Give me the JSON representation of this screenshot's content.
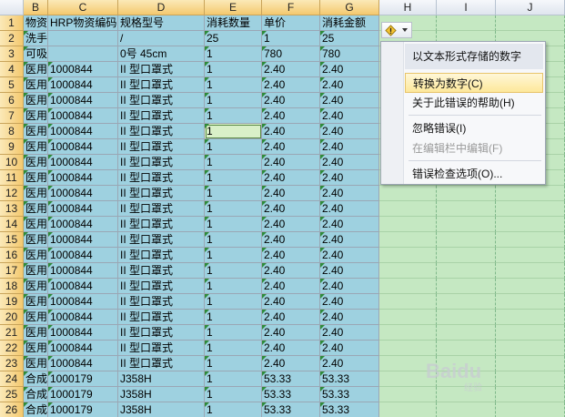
{
  "columns": [
    "B",
    "C",
    "D",
    "E",
    "F",
    "G",
    "H",
    "I",
    "J"
  ],
  "headers": [
    "物资名称",
    "HRP物资编码",
    "规格型号",
    "消耗数量",
    "单价",
    "消耗金额"
  ],
  "rows": [
    {
      "num": "1",
      "cells": [
        "物资名称",
        "HRP物资编码",
        "规格型号",
        "消耗数量",
        "单价",
        "消耗金额"
      ]
    },
    {
      "num": "2",
      "cells": [
        "洗手液",
        "",
        "/",
        "25",
        "1",
        "25"
      ]
    },
    {
      "num": "3",
      "cells": [
        "可吸收缝线",
        "",
        "0号 45cm",
        "1",
        "780",
        "780"
      ]
    },
    {
      "num": "4",
      "cells": [
        "医用口罩",
        "1000844",
        "II 型口罩式",
        "1",
        "2.40",
        "2.40"
      ]
    },
    {
      "num": "5",
      "cells": [
        "医用口罩",
        "1000844",
        "II 型口罩式",
        "1",
        "2.40",
        "2.40"
      ]
    },
    {
      "num": "6",
      "cells": [
        "医用口罩",
        "1000844",
        "II 型口罩式",
        "1",
        "2.40",
        "2.40"
      ]
    },
    {
      "num": "7",
      "cells": [
        "医用口罩",
        "1000844",
        "II 型口罩式",
        "1",
        "2.40",
        "2.40"
      ]
    },
    {
      "num": "8",
      "cells": [
        "医用口罩",
        "1000844",
        "II 型口罩式",
        "1",
        "2.40",
        "2.40"
      ]
    },
    {
      "num": "9",
      "cells": [
        "医用口罩",
        "1000844",
        "II 型口罩式",
        "1",
        "2.40",
        "2.40"
      ]
    },
    {
      "num": "10",
      "cells": [
        "医用口罩",
        "1000844",
        "II 型口罩式",
        "1",
        "2.40",
        "2.40"
      ]
    },
    {
      "num": "11",
      "cells": [
        "医用口罩",
        "1000844",
        "II 型口罩式",
        "1",
        "2.40",
        "2.40"
      ]
    },
    {
      "num": "12",
      "cells": [
        "医用口罩",
        "1000844",
        "II 型口罩式",
        "1",
        "2.40",
        "2.40"
      ]
    },
    {
      "num": "13",
      "cells": [
        "医用口罩",
        "1000844",
        "II 型口罩式",
        "1",
        "2.40",
        "2.40"
      ]
    },
    {
      "num": "14",
      "cells": [
        "医用口罩",
        "1000844",
        "II 型口罩式",
        "1",
        "2.40",
        "2.40"
      ]
    },
    {
      "num": "15",
      "cells": [
        "医用口罩",
        "1000844",
        "II 型口罩式",
        "1",
        "2.40",
        "2.40"
      ]
    },
    {
      "num": "16",
      "cells": [
        "医用口罩",
        "1000844",
        "II 型口罩式",
        "1",
        "2.40",
        "2.40"
      ]
    },
    {
      "num": "17",
      "cells": [
        "医用口罩",
        "1000844",
        "II 型口罩式",
        "1",
        "2.40",
        "2.40"
      ]
    },
    {
      "num": "18",
      "cells": [
        "医用口罩",
        "1000844",
        "II 型口罩式",
        "1",
        "2.40",
        "2.40"
      ]
    },
    {
      "num": "19",
      "cells": [
        "医用口罩",
        "1000844",
        "II 型口罩式",
        "1",
        "2.40",
        "2.40"
      ]
    },
    {
      "num": "20",
      "cells": [
        "医用口罩",
        "1000844",
        "II 型口罩式",
        "1",
        "2.40",
        "2.40"
      ]
    },
    {
      "num": "21",
      "cells": [
        "医用口罩",
        "1000844",
        "II 型口罩式",
        "1",
        "2.40",
        "2.40"
      ]
    },
    {
      "num": "22",
      "cells": [
        "医用口罩",
        "1000844",
        "II 型口罩式",
        "1",
        "2.40",
        "2.40"
      ]
    },
    {
      "num": "23",
      "cells": [
        "医用口罩",
        "1000844",
        "II 型口罩式",
        "1",
        "2.40",
        "2.40"
      ]
    },
    {
      "num": "24",
      "cells": [
        "合成纤维",
        "1000179",
        "J358H",
        "1",
        "53.33",
        "53.33"
      ]
    },
    {
      "num": "25",
      "cells": [
        "合成纤维",
        "1000179",
        "J358H",
        "1",
        "53.33",
        "53.33"
      ]
    },
    {
      "num": "26",
      "cells": [
        "合成纤维",
        "1000179",
        "J358H",
        "1",
        "53.33",
        "53.33"
      ]
    }
  ],
  "error_button": {
    "icon": "warning-icon"
  },
  "context_menu": {
    "header": "以文本形式存储的数字",
    "items": [
      {
        "label": "转换为数字(C)",
        "highlighted": true,
        "disabled": false
      },
      {
        "label": "关于此错误的帮助(H)",
        "highlighted": false,
        "disabled": false
      },
      {
        "label": "忽略错误(I)",
        "highlighted": false,
        "disabled": false
      },
      {
        "label": "在编辑栏中编辑(F)",
        "highlighted": false,
        "disabled": true
      },
      {
        "label": "错误检查选项(O)...",
        "highlighted": false,
        "disabled": false
      }
    ]
  },
  "watermark": {
    "text": "Baidu",
    "sub": "经验"
  },
  "colors": {
    "selection": "#9ed1e0",
    "empty_cells": "#c5e8c2",
    "header_selected": "#f4c96f",
    "menu_highlight": "#fde89a"
  }
}
